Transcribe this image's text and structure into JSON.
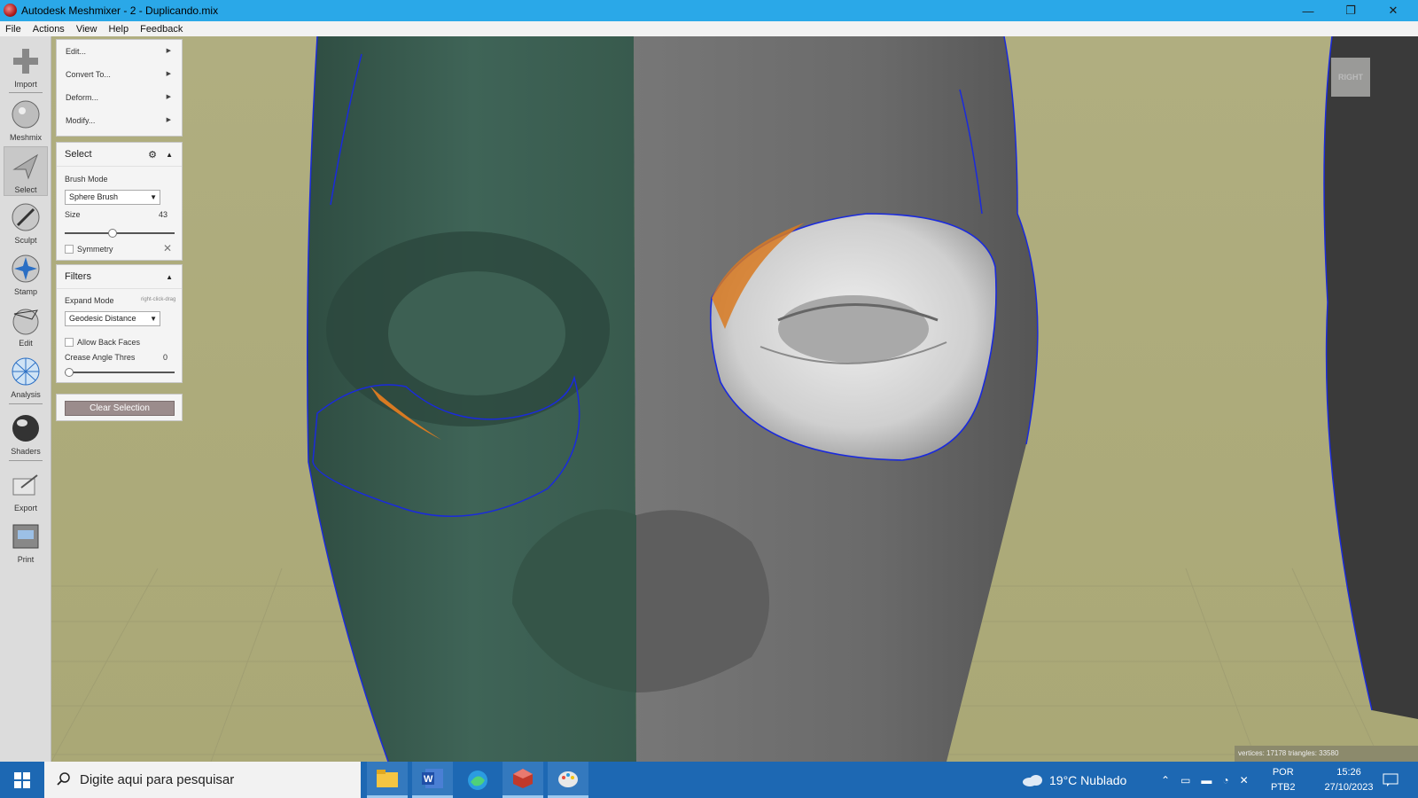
{
  "window": {
    "title": "Autodesk Meshmixer - 2 - Duplicando.mix",
    "minimize": "—",
    "maximize": "❐",
    "close": "✕"
  },
  "menu": [
    "File",
    "Actions",
    "View",
    "Help",
    "Feedback"
  ],
  "tools": [
    {
      "label": "Import",
      "icon": "plus-icon"
    },
    {
      "label": "Meshmix",
      "icon": "meshmix-ball-icon"
    },
    {
      "label": "Select",
      "icon": "select-arrow-icon",
      "active": true
    },
    {
      "label": "Sculpt",
      "icon": "brush-icon"
    },
    {
      "label": "Stamp",
      "icon": "stamp-icon"
    },
    {
      "label": "Edit",
      "icon": "edit-ball-icon"
    },
    {
      "label": "Analysis",
      "icon": "analysis-mesh-icon"
    },
    {
      "label": "Shaders",
      "icon": "shader-sphere-icon"
    },
    {
      "label": "Export",
      "icon": "export-icon"
    },
    {
      "label": "Print",
      "icon": "printer-icon"
    }
  ],
  "edit_menu": {
    "items": [
      "Edit...",
      "Convert To...",
      "Deform...",
      "Modify..."
    ]
  },
  "select_panel": {
    "title": "Select",
    "brush_mode_label": "Brush Mode",
    "brush_mode_value": "Sphere Brush",
    "size_label": "Size",
    "size_value": "43",
    "size_fraction": 0.43,
    "symmetry_label": "Symmetry"
  },
  "filters_panel": {
    "title": "Filters",
    "expand_mode_label": "Expand Mode",
    "expand_mode_hint": "right-click-drag",
    "expand_mode_value": "Geodesic Distance",
    "allow_back_faces_label": "Allow Back Faces",
    "crease_angle_label": "Crease Angle Thres",
    "crease_angle_value": "0",
    "crease_fraction": 0.0
  },
  "clear_selection_label": "Clear Selection",
  "viewcube_label": "RIGHT",
  "status_info": "vertices: 17178 triangles: 33580",
  "taskbar": {
    "search_placeholder": "Digite aqui para pesquisar",
    "weather": "19°C  Nublado",
    "lang_line1": "POR",
    "lang_line2": "PTB2",
    "time": "15:26",
    "date": "27/10/2023"
  },
  "colors": {
    "titlebar": "#2aa8e8",
    "viewport_bg": "#b0ae80",
    "mesh_left": "#3c5f52",
    "mesh_right": "#6e6e6e",
    "selection_outline": "#1a2adc",
    "selection_highlight": "#d87a22",
    "taskbar": "#1d68b3"
  }
}
